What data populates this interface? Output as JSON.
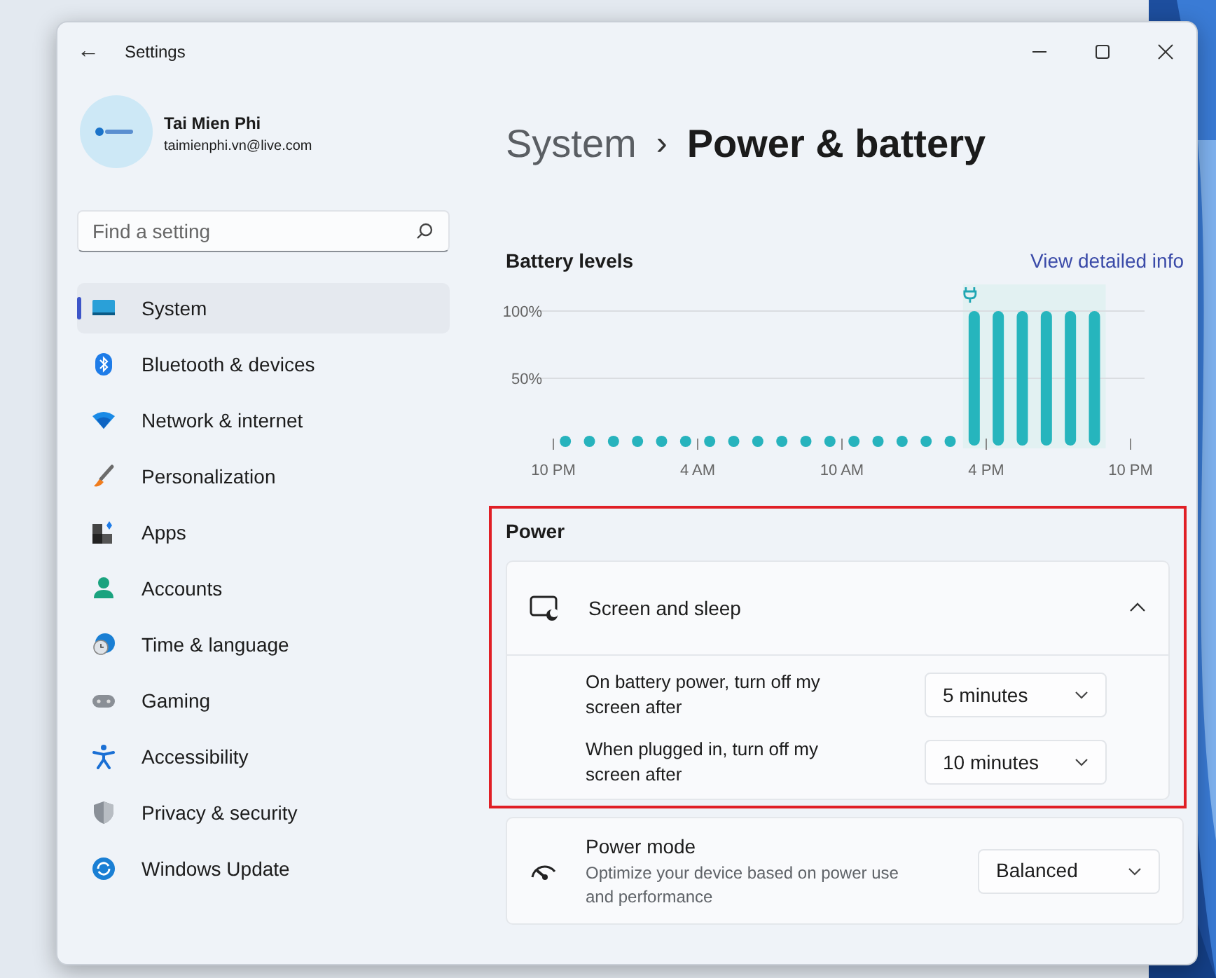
{
  "window": {
    "title": "Settings",
    "back": "←"
  },
  "profile": {
    "name": "Tai Mien Phi",
    "email": "taimienphi.vn@live.com"
  },
  "search": {
    "placeholder": "Find a setting"
  },
  "sidebar": {
    "items": [
      {
        "label": "System",
        "selected": true
      },
      {
        "label": "Bluetooth & devices",
        "selected": false
      },
      {
        "label": "Network & internet",
        "selected": false
      },
      {
        "label": "Personalization",
        "selected": false
      },
      {
        "label": "Apps",
        "selected": false
      },
      {
        "label": "Accounts",
        "selected": false
      },
      {
        "label": "Time & language",
        "selected": false
      },
      {
        "label": "Gaming",
        "selected": false
      },
      {
        "label": "Accessibility",
        "selected": false
      },
      {
        "label": "Privacy & security",
        "selected": false
      },
      {
        "label": "Windows Update",
        "selected": false
      }
    ]
  },
  "breadcrumb": {
    "parent": "System",
    "separator": "›",
    "current": "Power & battery"
  },
  "battery": {
    "title": "Battery levels",
    "link": "View detailed info",
    "chart_data": {
      "type": "bar",
      "categories": [
        "10 PM",
        null,
        null,
        null,
        null,
        null,
        "4 AM",
        null,
        null,
        null,
        null,
        null,
        "10 AM",
        null,
        null,
        null,
        null,
        null,
        "4 PM",
        null,
        null,
        null,
        null,
        null,
        "10 PM"
      ],
      "values": [
        0,
        0,
        0,
        0,
        0,
        0,
        0,
        0,
        0,
        0,
        0,
        0,
        0,
        0,
        0,
        0,
        0,
        100,
        100,
        100,
        100,
        100,
        100,
        null,
        null
      ],
      "ylim": [
        0,
        100
      ],
      "yticks": [
        {
          "value": 50,
          "label": "50%"
        },
        {
          "value": 100,
          "label": "100%"
        }
      ]
    }
  },
  "power": {
    "title": "Power",
    "highlighted": true,
    "cards": [
      {
        "kind": "expander",
        "title": "Screen and sleep",
        "expanded": true,
        "settings": [
          {
            "label": "On battery power, turn off my screen after",
            "value": "5 minutes"
          },
          {
            "label": "When plugged in, turn off my screen after",
            "value": "10 minutes"
          }
        ]
      },
      {
        "kind": "dropdown",
        "title": "Power mode",
        "description": "Optimize your device based on power use and performance",
        "value": "Balanced"
      }
    ]
  }
}
